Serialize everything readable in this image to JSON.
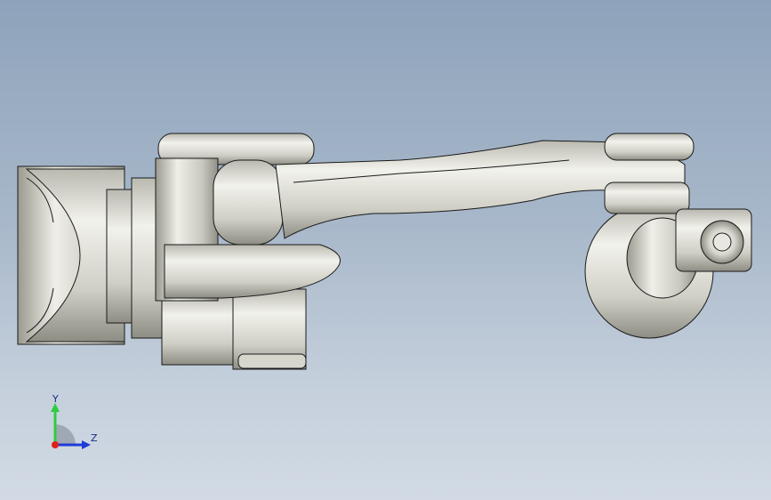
{
  "viewport": {
    "background_top": "#8ea3bb",
    "background_bottom": "#d2dbe5"
  },
  "model": {
    "part_color": "#d9d9d0",
    "shadow_color": "#8a8a80",
    "edge_color": "#1a1a1a"
  },
  "triad": {
    "y_label": "Y",
    "z_label": "Z",
    "y_color": "#2ecc40",
    "z_color": "#1f3bd6",
    "x_color": "#e0201a"
  }
}
